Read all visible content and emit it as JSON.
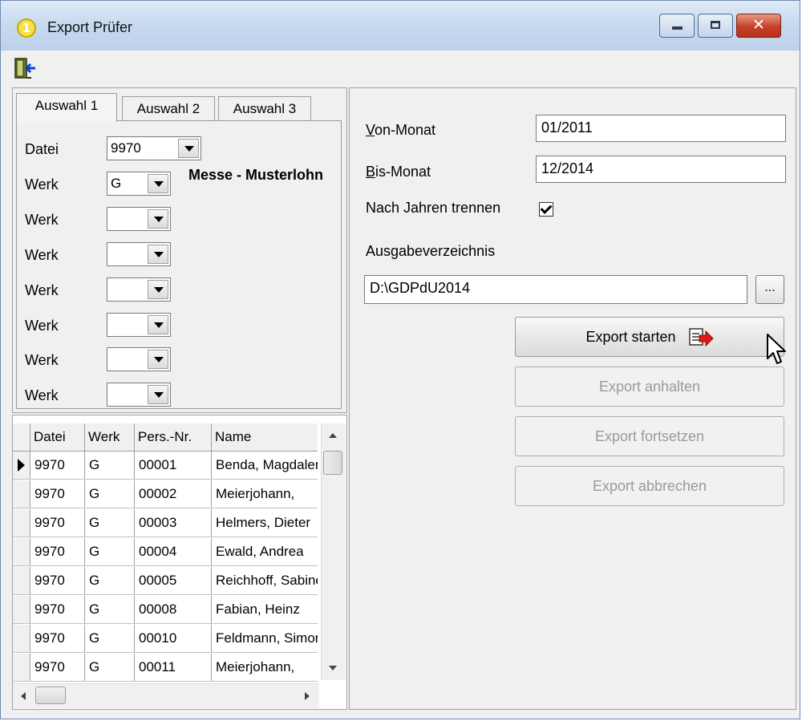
{
  "window": {
    "title": "Export Prüfer",
    "logo_glyph": "1",
    "close_glyph": "✕",
    "logo_color": "#f4e04a",
    "close_color": "#c5402a"
  },
  "toolbar": {
    "exit_icon": "exit-door-icon"
  },
  "tabs": [
    {
      "label": "Auswahl 1",
      "active": true
    },
    {
      "label": "Auswahl 2",
      "active": false
    },
    {
      "label": "Auswahl 3",
      "active": false
    }
  ],
  "selection": {
    "datei_label": "Datei",
    "datei_value": "9970",
    "werk_label": "Werk",
    "werk_rows": [
      {
        "value": "G"
      },
      {
        "value": ""
      },
      {
        "value": ""
      },
      {
        "value": ""
      },
      {
        "value": ""
      },
      {
        "value": ""
      },
      {
        "value": ""
      }
    ],
    "werk_name": "Messe - Musterlohn"
  },
  "grid": {
    "columns": [
      "Datei",
      "Werk",
      "Pers.-Nr.",
      "Name"
    ],
    "rows": [
      {
        "datei": "9970",
        "werk": "G",
        "persnr": "00001",
        "name": "Benda, Magdalena",
        "current": true
      },
      {
        "datei": "9970",
        "werk": "G",
        "persnr": "00002",
        "name": "Meierjohann, ",
        "current": false
      },
      {
        "datei": "9970",
        "werk": "G",
        "persnr": "00003",
        "name": "Helmers, Dieter",
        "current": false
      },
      {
        "datei": "9970",
        "werk": "G",
        "persnr": "00004",
        "name": "Ewald, Andrea",
        "current": false
      },
      {
        "datei": "9970",
        "werk": "G",
        "persnr": "00005",
        "name": "Reichhoff, Sabine",
        "current": false
      },
      {
        "datei": "9970",
        "werk": "G",
        "persnr": "00008",
        "name": "Fabian, Heinz",
        "current": false
      },
      {
        "datei": "9970",
        "werk": "G",
        "persnr": "00010",
        "name": "Feldmann, Simone",
        "current": false
      },
      {
        "datei": "9970",
        "werk": "G",
        "persnr": "00011",
        "name": "Meierjohann, ",
        "current": false
      }
    ]
  },
  "export": {
    "von_label_accel": "V",
    "von_label_rest": "on-Monat",
    "von_value": "01/2011",
    "bis_label_accel": "B",
    "bis_label_rest": "is-Monat",
    "bis_value": "12/2014",
    "split_label": "Nach Jahren trennen",
    "split_checked": true,
    "dir_label": "Ausgabeverzeichnis",
    "dir_value": "D:\\GDPdU2014",
    "browse_label": "...",
    "start_label": "Export starten",
    "pause_label": "Export anhalten",
    "resume_label": "Export fortsetzen",
    "cancel_label": "Export abbrechen"
  }
}
